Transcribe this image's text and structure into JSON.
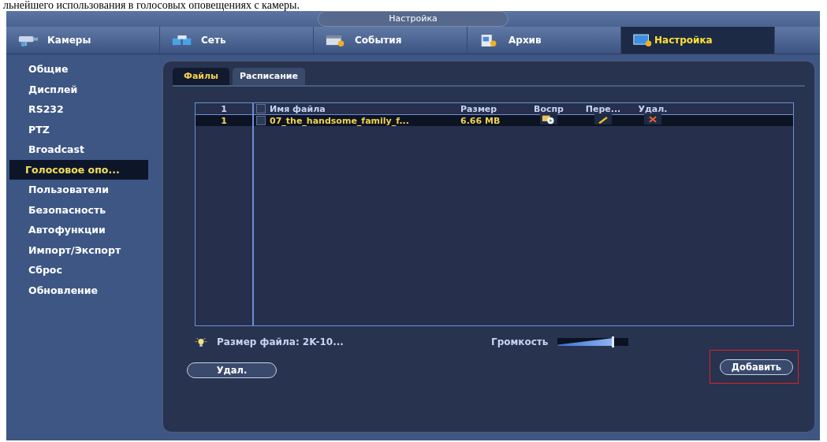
{
  "doc_caption": "льнейшего использования  в голосовых оповещениях с камеры.",
  "window": {
    "title": "Настройка"
  },
  "main_tabs": [
    {
      "label": "Камеры",
      "kind": "camera",
      "selected": false
    },
    {
      "label": "Сеть",
      "kind": "network",
      "selected": false
    },
    {
      "label": "События",
      "kind": "events",
      "selected": false
    },
    {
      "label": "Архив",
      "kind": "archive",
      "selected": false
    },
    {
      "label": "Настройка",
      "kind": "settings",
      "selected": true
    }
  ],
  "sidebar": {
    "items": [
      {
        "label": "Общие",
        "selected": false
      },
      {
        "label": "Дисплей",
        "selected": false
      },
      {
        "label": "RS232",
        "selected": false
      },
      {
        "label": "PTZ",
        "selected": false
      },
      {
        "label": "Broadcast",
        "selected": false
      },
      {
        "label": "Голосовое опо...",
        "selected": true
      },
      {
        "label": "Пользователи",
        "selected": false
      },
      {
        "label": "Безопасность",
        "selected": false
      },
      {
        "label": "Автофункции",
        "selected": false
      },
      {
        "label": "Импорт/Экспорт",
        "selected": false
      },
      {
        "label": "Сброс",
        "selected": false
      },
      {
        "label": "Обновление",
        "selected": false
      }
    ]
  },
  "sub_tabs": [
    {
      "label": "Файлы",
      "selected": true
    },
    {
      "label": "Расписание",
      "selected": false
    }
  ],
  "table": {
    "header": {
      "number": "1",
      "checked": false,
      "columns": [
        "Имя файла",
        "Размер",
        "Воспр",
        "Пере...",
        "Удал."
      ]
    },
    "rows": [
      {
        "number": "1",
        "checked": false,
        "selected": true,
        "name": "07_the_handsome_family_f...",
        "size": "6.66 MB"
      }
    ]
  },
  "hint": "Размер файла: 2K-10...",
  "volume": {
    "label": "Громкость",
    "level": 0.78
  },
  "buttons": {
    "delete": "Удал.",
    "add": "Добавить"
  },
  "highlight": true
}
